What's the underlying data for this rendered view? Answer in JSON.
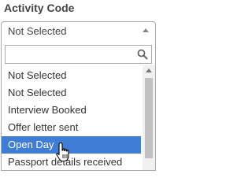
{
  "field": {
    "label": "Activity Code"
  },
  "select": {
    "selected": "Not Selected",
    "arrow_icon": "chevron-up-icon"
  },
  "search": {
    "value": "",
    "placeholder": "",
    "icon": "search-icon"
  },
  "options": [
    {
      "label": "Not Selected",
      "highlighted": false
    },
    {
      "label": "Not Selected",
      "highlighted": false
    },
    {
      "label": "Interview Booked",
      "highlighted": false
    },
    {
      "label": "Offer letter sent",
      "highlighted": false
    },
    {
      "label": "Open Day",
      "highlighted": true
    },
    {
      "label": "Passport details received",
      "highlighted": false
    }
  ],
  "colors": {
    "highlight": "#3f7dd6",
    "border": "#aaaaaa"
  },
  "cursor": "hand-pointer-icon"
}
